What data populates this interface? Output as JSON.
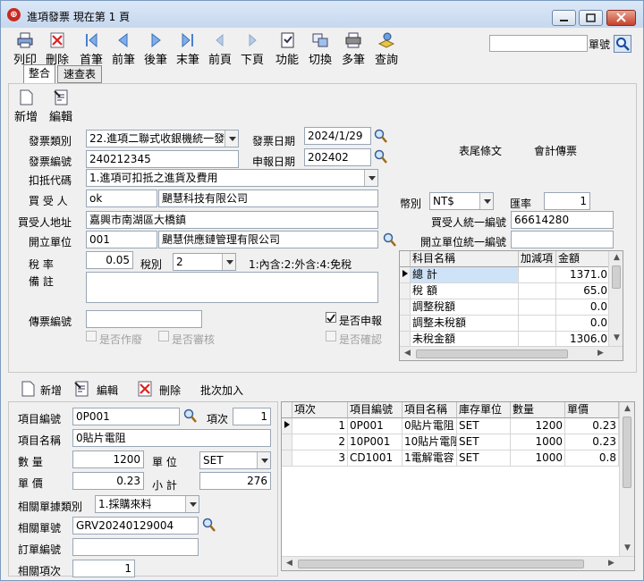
{
  "window": {
    "title": "進項發票  現在第 1 頁",
    "app_icon_glyph": "⊕"
  },
  "toolbar": {
    "print": "列印",
    "delete": "刪除",
    "first": "首筆",
    "prev": "前筆",
    "next": "後筆",
    "last": "末筆",
    "prev_page": "前頁",
    "next_page": "下頁",
    "function": "功能",
    "switch": "切換",
    "multi": "多筆",
    "query": "查詢",
    "search_label": "單號",
    "search_value": ""
  },
  "tabs": [
    "整合",
    "速查表"
  ],
  "actions": {
    "add": "新增",
    "edit": "編輯"
  },
  "header": {
    "invoice_type_label": "發票類別",
    "invoice_type": "22.進項二聯式收銀機統一發",
    "invoice_date_label": "發票日期",
    "invoice_date": "2024/1/29",
    "invoice_no_label": "發票編號",
    "invoice_no": "240212345",
    "report_date_label": "申報日期",
    "report_date": "202402",
    "footer_text": "表尾條文",
    "accounting_voucher": "會計傳票",
    "deduction_label": "扣抵代碼",
    "deduction": "1.進項可扣抵之進貨及費用",
    "buyer_label": "買 受 人",
    "buyer_code": "ok",
    "buyer_name": "颶慧科技有限公司",
    "currency_label": "幣別",
    "currency": "NT$",
    "rate_label": "匯率",
    "rate": "1",
    "buyer_addr_label": "買受人地址",
    "buyer_addr": "嘉興市南湖區大橋鎮",
    "buyer_taxid_label": "買受人統一編號",
    "buyer_taxid": "66614280",
    "issuer_label": "開立單位",
    "issuer_code": "001",
    "issuer_name": "颶慧供應鏈管理有限公司",
    "issuer_taxid_label": "開立單位統一編號",
    "issuer_taxid": "",
    "tax_rate_label": "稅  率",
    "tax_rate": "0.05",
    "tax_type_label": "稅別",
    "tax_type": "2",
    "tax_hint": "1:內含:2:外含:4:免稅",
    "note_label": "備  註",
    "note": "",
    "voucher_no_label": "傳票編號",
    "voucher_no": "",
    "declare_label": "是否申報",
    "void_label": "是否作廢",
    "audit_label": "是否審核",
    "confirm_label": "是否確認"
  },
  "summary_grid": {
    "columns": [
      "科目名稱",
      "加減項",
      "金額"
    ],
    "rows": [
      {
        "name": "總    計",
        "sign": "",
        "amount": "1371.0"
      },
      {
        "name": "稅    額",
        "sign": "",
        "amount": "65.0"
      },
      {
        "name": "調整稅額",
        "sign": "",
        "amount": "0.0"
      },
      {
        "name": "調整未稅額",
        "sign": "",
        "amount": "0.0"
      },
      {
        "name": "未稅金額",
        "sign": "",
        "amount": "1306.0"
      }
    ]
  },
  "detail_toolbar": {
    "add": "新增",
    "edit": "編輯",
    "delete": "刪除",
    "batch_add": "批次加入"
  },
  "detail": {
    "item_code_label": "項目編號",
    "item_code": "0P001",
    "seq_label": "項次",
    "seq": "1",
    "item_name_label": "項目名稱",
    "item_name": "0貼片電阻",
    "qty_label": "數  量",
    "qty": "1200",
    "unit_label": "單  位",
    "unit": "SET",
    "price_label": "單  價",
    "price": "0.23",
    "subtotal_label": "小  計",
    "subtotal": "276",
    "ref_type_label": "相關單據類別",
    "ref_type": "1.採購來料",
    "ref_no_label": "相關單號",
    "ref_no": "GRV20240129004",
    "order_no_label": "訂單編號",
    "order_no": "",
    "ref_seq_label": "相關項次",
    "ref_seq": "1"
  },
  "items_grid": {
    "columns": [
      "項次",
      "項目編號",
      "項目名稱",
      "庫存單位",
      "數量",
      "單價"
    ],
    "rows": [
      {
        "seq": "1",
        "code": "0P001",
        "name": "0貼片電阻",
        "unit": "SET",
        "qty": "1200",
        "price": "0.23"
      },
      {
        "seq": "2",
        "code": "10P001",
        "name": "10貼片電阻",
        "unit": "SET",
        "qty": "1000",
        "price": "0.23"
      },
      {
        "seq": "3",
        "code": "CD1001",
        "name": "1電解電容",
        "unit": "SET",
        "qty": "1000",
        "price": "0.8"
      }
    ]
  }
}
